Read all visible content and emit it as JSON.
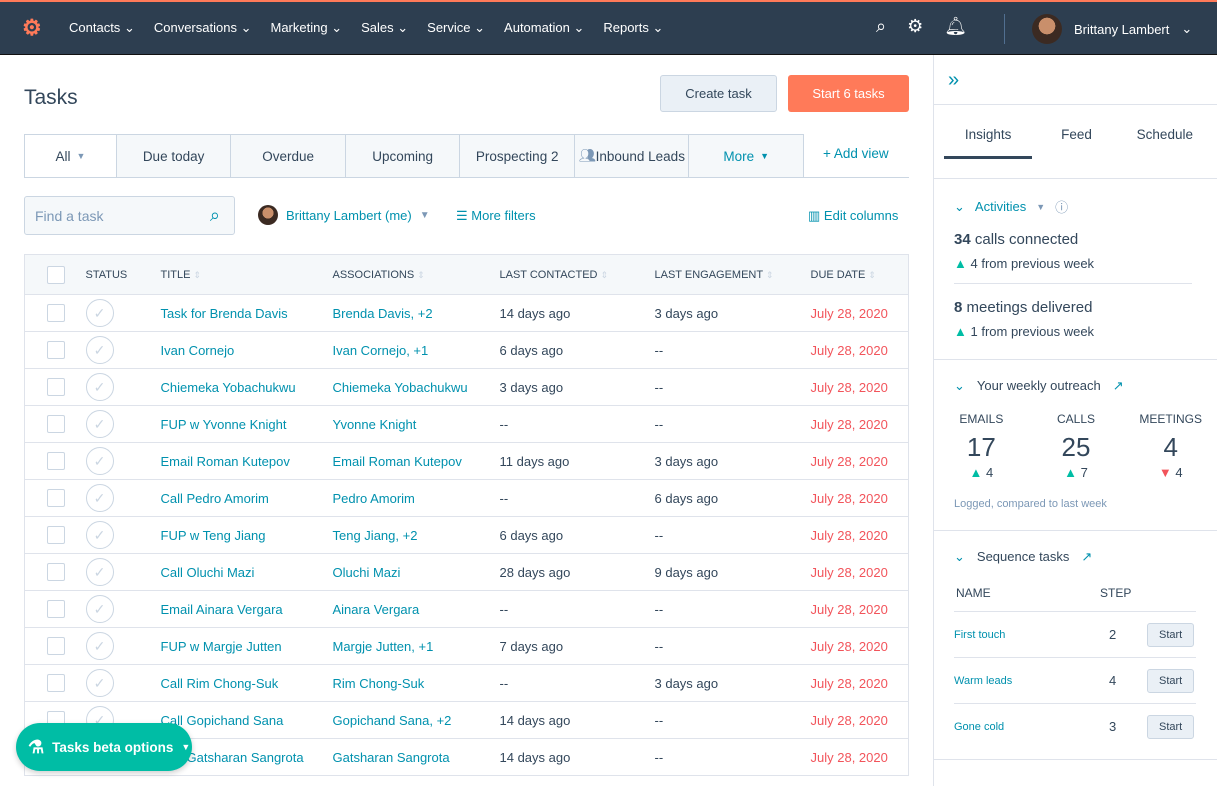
{
  "nav": {
    "items": [
      "Contacts",
      "Conversations",
      "Marketing",
      "Sales",
      "Service",
      "Automation",
      "Reports"
    ],
    "user": "Brittany Lambert",
    "icons": [
      "search-icon",
      "gear-icon",
      "bell-icon"
    ]
  },
  "page": {
    "title": "Tasks",
    "create_label": "Create task",
    "start_label": "Start 6 tasks"
  },
  "tabs": [
    "All",
    "Due today",
    "Overdue",
    "Upcoming",
    "Prospecting 2",
    "Inbound Leads",
    "More"
  ],
  "add_view": "Add view",
  "filters": {
    "search_placeholder": "Find a task",
    "owner": "Brittany Lambert (me)",
    "more_filters": "More filters",
    "edit_columns": "Edit columns"
  },
  "table": {
    "headers": [
      "STATUS",
      "TITLE",
      "ASSOCIATIONS",
      "LAST CONTACTED",
      "LAST ENGAGEMENT",
      "DUE DATE"
    ],
    "rows": [
      [
        "Task for Brenda Davis",
        "Brenda Davis, +2",
        "14 days ago",
        "3 days ago",
        "July 28, 2020"
      ],
      [
        "Ivan Cornejo",
        "Ivan Cornejo, +1",
        "6 days ago",
        "--",
        "July 28, 2020"
      ],
      [
        "Chiemeka Yobachukwu",
        "Chiemeka Yobachukwu",
        "3 days ago",
        "--",
        "July 28, 2020"
      ],
      [
        "FUP w Yvonne Knight",
        "Yvonne Knight",
        "--",
        "--",
        "July 28, 2020"
      ],
      [
        "Email Roman Kutepov",
        "Email Roman Kutepov",
        "11 days ago",
        "3 days ago",
        "July 28, 2020"
      ],
      [
        "Call Pedro Amorim",
        "Pedro Amorim",
        "--",
        "6 days ago",
        "July 28, 2020"
      ],
      [
        "FUP w Teng Jiang",
        "Teng Jiang, +2",
        "6 days ago",
        "--",
        "July 28, 2020"
      ],
      [
        "Call Oluchi Mazi",
        "Oluchi Mazi",
        "28 days ago",
        "9 days ago",
        "July 28, 2020"
      ],
      [
        "Email Ainara Vergara",
        "Ainara Vergara",
        "--",
        "--",
        "July 28, 2020"
      ],
      [
        "FUP w Margje Jutten",
        "Margje Jutten, +1",
        "7 days ago",
        "--",
        "July 28, 2020"
      ],
      [
        "Call Rim Chong-Suk",
        "Rim Chong-Suk",
        "--",
        "3 days ago",
        "July 28, 2020"
      ],
      [
        "Call Gopichand Sana",
        "Gopichand Sana, +2",
        "14 days ago",
        "--",
        "July 28, 2020"
      ],
      [
        "Call Gatsharan Sangrota",
        "Gatsharan Sangrota",
        "14 days ago",
        "--",
        "July 28, 2020"
      ]
    ]
  },
  "beta_label": "Tasks beta options",
  "sidebar": {
    "tabs": [
      "Insights",
      "Feed",
      "Schedule"
    ],
    "activities": {
      "title": "Activities",
      "calls_value": "34",
      "calls_label": "calls connected",
      "calls_change": "4 from previous week",
      "meetings_value": "8",
      "meetings_label": "meetings delivered",
      "meetings_change": "1 from previous week"
    },
    "outreach": {
      "title": "Your weekly outreach",
      "stats": [
        {
          "label": "EMAILS",
          "value": "17",
          "change": "4",
          "dir": "up"
        },
        {
          "label": "CALLS",
          "value": "25",
          "change": "7",
          "dir": "up"
        },
        {
          "label": "MEETINGS",
          "value": "4",
          "change": "4",
          "dir": "down"
        }
      ],
      "note": "Logged, compared to last week"
    },
    "sequence": {
      "title": "Sequence tasks",
      "name_header": "NAME",
      "step_header": "STEP",
      "rows": [
        {
          "name": "First touch",
          "step": "2",
          "action": "Start"
        },
        {
          "name": "Warm leads",
          "step": "4",
          "action": "Start"
        },
        {
          "name": "Gone cold",
          "step": "3",
          "action": "Start"
        }
      ]
    }
  },
  "colors": {
    "nav": "#2d3e50",
    "accent": "#ff7a59",
    "link": "#0091ae",
    "due": "#f2545b",
    "up": "#00bda5"
  }
}
